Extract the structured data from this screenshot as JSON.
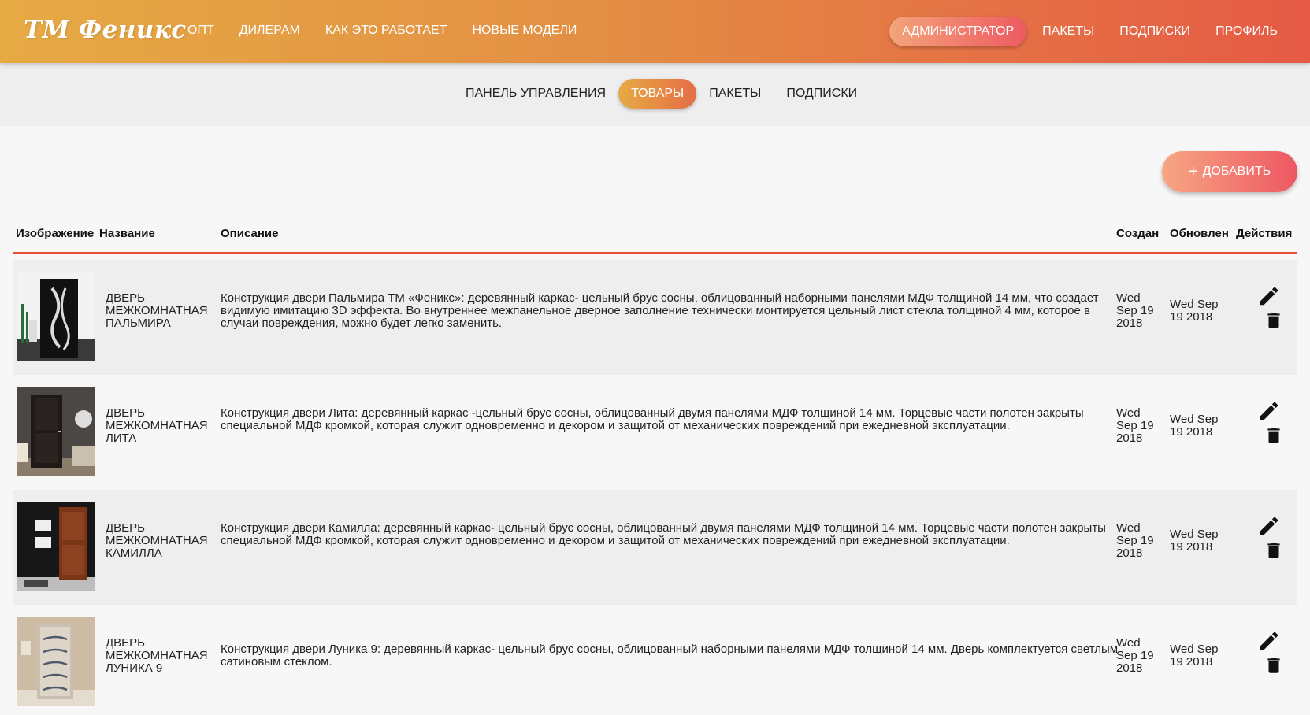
{
  "brand": "ТМ Феникс",
  "topnav_left": [
    "Опт",
    "Дилерам",
    "Как это работает",
    "Новые модели"
  ],
  "topnav_right": {
    "admin": "Администратор",
    "packages": "Пакеты",
    "subscriptions": "Подписки",
    "profile": "Профиль"
  },
  "subnav": {
    "dashboard": "Панель управления",
    "products": "Товары",
    "packages": "Пакеты",
    "subscriptions": "Подписки"
  },
  "add_button": {
    "icon": "plus-icon",
    "label": "Добавить"
  },
  "table": {
    "columns": {
      "image": "Изображение",
      "name": "Название",
      "description": "Описание",
      "created": "Создан",
      "updated": "Обновлен",
      "actions": "Действия"
    },
    "rows": [
      {
        "name": "Дверь межкомнатная Пальмира",
        "description": "Конструкция двери Пальмира ТМ «Феникс»: деревянный каркас- цельный брус сосны, облицованный наборными панелями МДФ толщиной 14 мм, что создает видимую имитацию 3D эффекта. Во внутреннее межпанельное дверное заполнение технически монтируется цельный лист стекла толщиной 4 мм, которое в случаи повреждения, можно будет легко заменить.",
        "created": "Wed Sep 19 2018",
        "updated": "Wed Sep 19 2018"
      },
      {
        "name": "Дверь межкомнатная Лита",
        "description": "Конструкция двери Лита: деревянный каркас -цельный брус сосны, облицованный двумя панелями МДФ толщиной 14 мм. Торцевые части полотен закрыты специальной МДФ кромкой, которая служит одновременно и декором и защитой от механических повреждений при ежедневной эксплуатации.",
        "created": "Wed Sep 19 2018",
        "updated": "Wed Sep 19 2018"
      },
      {
        "name": "Дверь межкомнатная Камилла",
        "description": "Конструкция двери Камилла: деревянный каркас- цельный брус сосны, облицованный двумя панелями МДФ толщиной 14 мм. Торцевые части полотен закрыты специальной МДФ кромкой, которая служит одновременно и декором и защитой от механических повреждений при ежедневной эксплуатации.",
        "created": "Wed Sep 19 2018",
        "updated": "Wed Sep 19 2018"
      },
      {
        "name": "Дверь межкомнатная Луника 9",
        "description": "Конструкция двери Луника 9: деревянный каркас- цельный брус сосны, облицованный наборными панелями МДФ толщиной 14 мм. Дверь комплектуется светлым сатиновым стеклом.",
        "created": "Wed Sep 19 2018",
        "updated": "Wed Sep 19 2018"
      }
    ]
  },
  "icons": {
    "edit": "pencil-icon",
    "delete": "trash-icon"
  },
  "colors": {
    "accent_start": "#e6aa44",
    "accent_end": "#e55a45",
    "header_rule": "#e5503a"
  }
}
